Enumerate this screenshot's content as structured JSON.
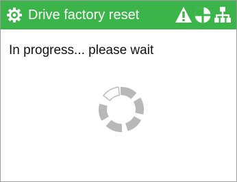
{
  "header": {
    "title": "Drive factory reset",
    "icons": [
      "gear-icon",
      "warning-icon",
      "target-icon",
      "network-icon"
    ]
  },
  "main": {
    "status_message": "In progress... please wait",
    "spinner": "loading-spinner"
  },
  "colors": {
    "title_bar": "#3bb54a",
    "title_text": "#ffffff",
    "spinner_segment": "#b8b8b8"
  }
}
